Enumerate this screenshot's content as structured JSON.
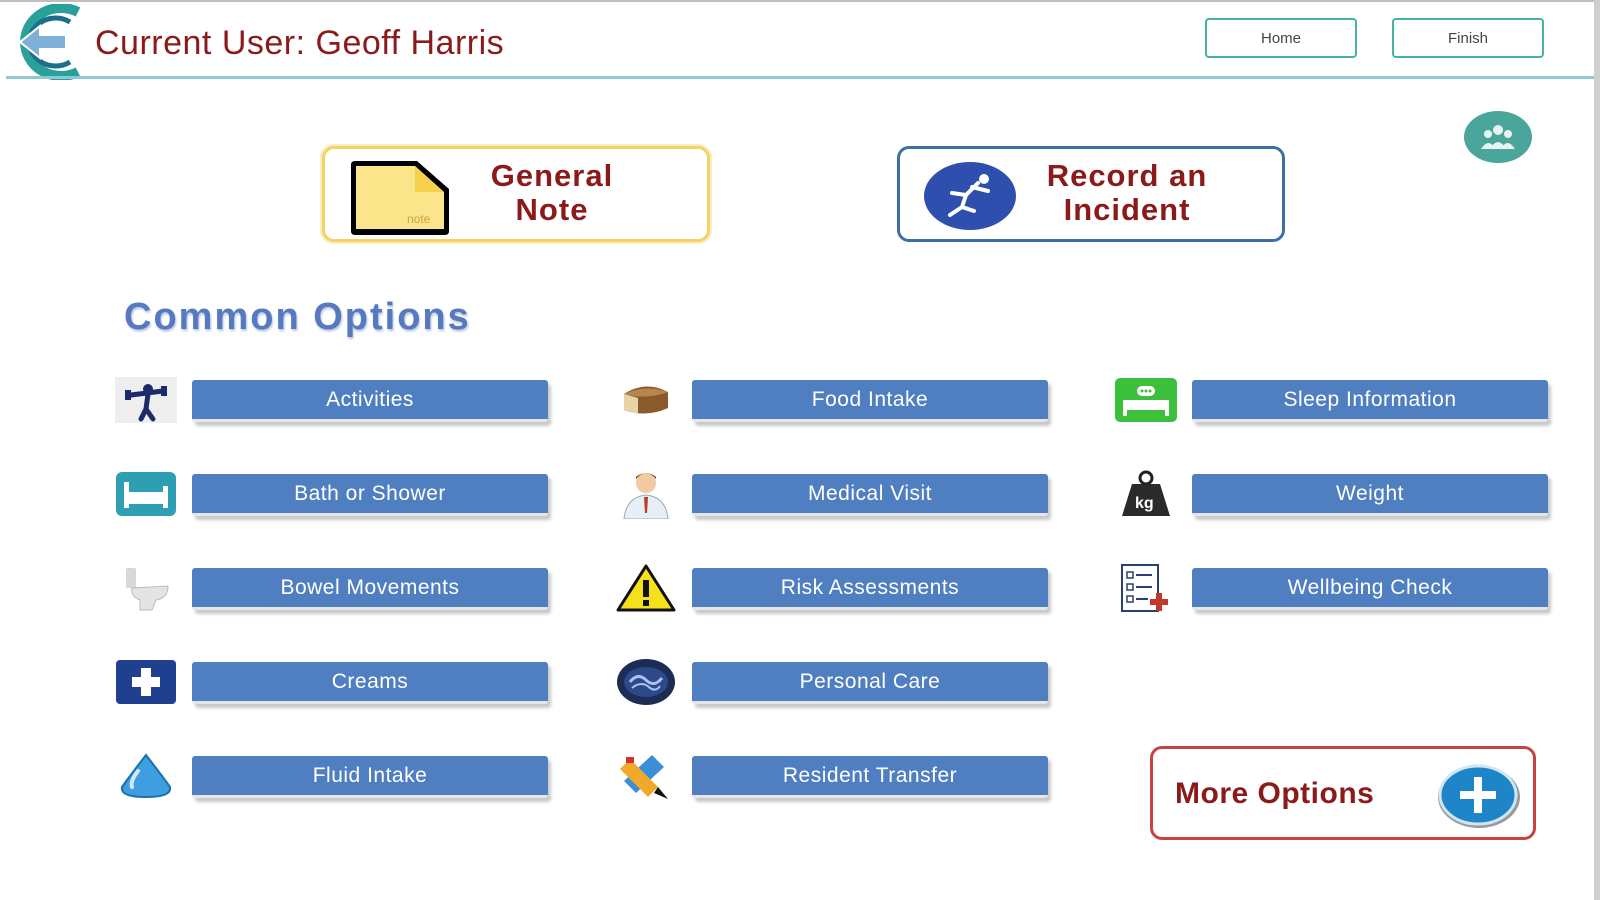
{
  "header": {
    "current_user": "Current User: Geoff Harris",
    "home_label": "Home",
    "finish_label": "Finish"
  },
  "actions": {
    "general_note_line1": "General",
    "general_note_line2": "Note",
    "incident_line1": "Record an",
    "incident_line2": "Incident",
    "note_sticker_text": "note"
  },
  "section_title": "Common Options",
  "options": {
    "col1": [
      "Activities",
      "Bath or Shower",
      "Bowel Movements",
      "Creams",
      "Fluid Intake"
    ],
    "col2": [
      "Food Intake",
      "Medical Visit",
      "Risk Assessments",
      "Personal Care",
      "Resident Transfer"
    ],
    "col3": [
      "Sleep Information",
      "Weight",
      "Wellbeing Check"
    ]
  },
  "weight_icon_text": "kg",
  "more_options_label": "More Options",
  "colors": {
    "accent_teal": "#45b3a6",
    "option_blue": "#4f7fc0",
    "title_red": "#8b1a1a",
    "section_blue": "#5679bf"
  },
  "icons": {
    "logo": "app-logo-icon",
    "group": "group-icon",
    "note": "sticky-note-icon",
    "incident": "falling-person-icon",
    "activities": "exercise-icon",
    "bath": "bathtub-icon",
    "bowel": "toilet-icon",
    "creams": "medical-cross-icon",
    "fluid": "water-drop-icon",
    "food": "bread-icon",
    "medical": "doctor-icon",
    "risk": "warning-icon",
    "personal_care": "personal-care-icon",
    "transfer": "transfer-icon",
    "sleep": "bed-icon",
    "weight": "weight-kg-icon",
    "wellbeing": "checklist-icon",
    "more": "plus-circle-icon"
  }
}
